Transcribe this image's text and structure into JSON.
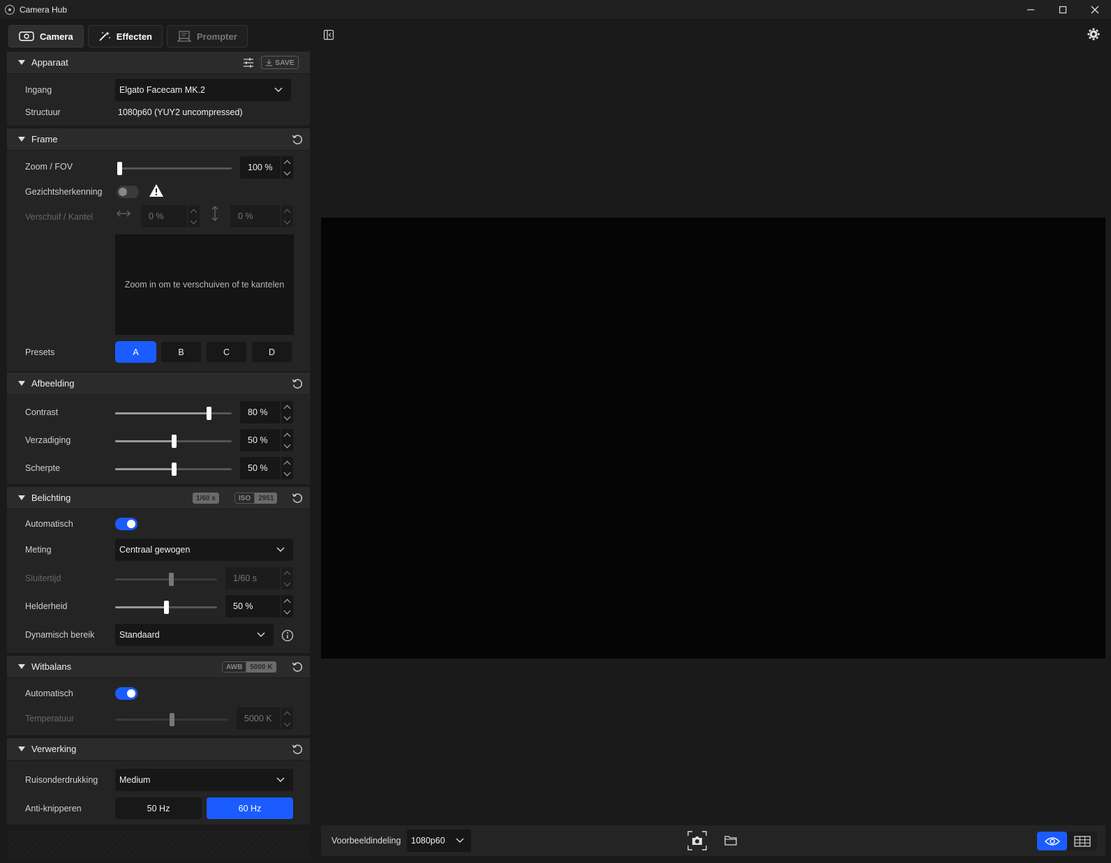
{
  "window": {
    "title": "Camera Hub"
  },
  "tabs": [
    {
      "label": "Camera"
    },
    {
      "label": "Effecten"
    },
    {
      "label": "Prompter"
    }
  ],
  "apparaat": {
    "title": "Apparaat",
    "save_label": "SAVE",
    "ingang_label": "Ingang",
    "ingang_value": "Elgato Facecam MK.2",
    "structuur_label": "Structuur",
    "structuur_value": "1080p60 (YUY2 uncompressed)"
  },
  "frame": {
    "title": "Frame",
    "zoom_label": "Zoom / FOV",
    "zoom_value": "100 %",
    "zoom_level": 0,
    "face_label": "Gezichtsherkenning",
    "pantilt_label": "Verschuif / Kantel",
    "pan_value": "0 %",
    "tilt_value": "0 %",
    "pantilt_hint": "Zoom in om te verschuiven of te kantelen",
    "presets_label": "Presets",
    "presets": [
      "A",
      "B",
      "C",
      "D"
    ],
    "active_preset": "A"
  },
  "afbeelding": {
    "title": "Afbeelding",
    "contrast_label": "Contrast",
    "contrast_value": "80 %",
    "contrast_level": 0.8,
    "verzadiging_label": "Verzadiging",
    "verzadiging_value": "50 %",
    "verzadiging_level": 0.5,
    "scherpte_label": "Scherpte",
    "scherpte_value": "50 %",
    "scherpte_level": 0.5
  },
  "belichting": {
    "title": "Belichting",
    "badge_shutter": "1/60 s",
    "badge_iso_label": "ISO",
    "badge_iso_value": "2951",
    "auto_label": "Automatisch",
    "meting_label": "Meting",
    "meting_value": "Centraal gewogen",
    "sluitertijd_label": "Sluitertijd",
    "sluitertijd_value": "1/60 s",
    "sluitertijd_level": 0.55,
    "helderheid_label": "Helderheid",
    "helderheid_value": "50 %",
    "helderheid_level": 0.5,
    "bereik_label": "Dynamisch bereik",
    "bereik_value": "Standaard"
  },
  "witbalans": {
    "title": "Witbalans",
    "badge_awb": "AWB",
    "badge_temp": "5000 K",
    "auto_label": "Automatisch",
    "temp_label": "Temperatuur",
    "temp_value": "5000 K",
    "temp_level": 0.5
  },
  "verwerking": {
    "title": "Verwerking",
    "ruis_label": "Ruisonderdrukking",
    "ruis_value": "Medium",
    "anti_label": "Anti-knipperen",
    "hz_50": "50 Hz",
    "hz_60": "60 Hz",
    "active_hz": "60 Hz"
  },
  "bottom": {
    "layout_label": "Voorbeeldindeling",
    "layout_value": "1080p60"
  }
}
